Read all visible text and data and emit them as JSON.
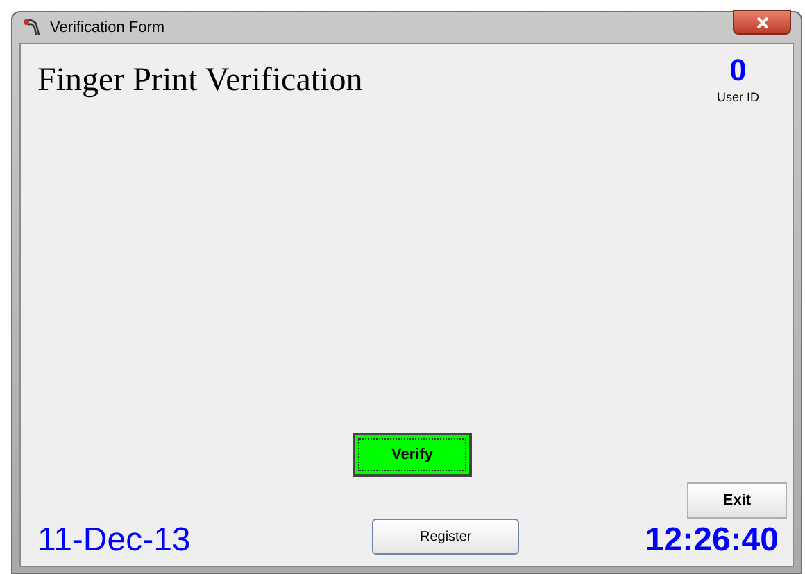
{
  "window": {
    "title": "Verification Form"
  },
  "heading": "Finger Print Verification",
  "user": {
    "id": "0",
    "label": "User ID"
  },
  "buttons": {
    "verify": "Verify",
    "register": "Register",
    "exit": "Exit"
  },
  "status": {
    "date": "11-Dec-13",
    "time": "12:26:40"
  }
}
